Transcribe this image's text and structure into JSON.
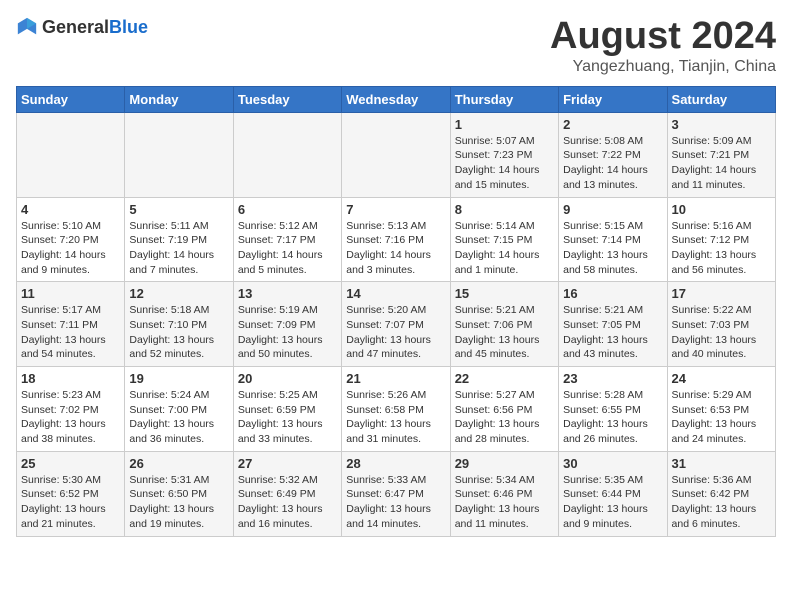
{
  "header": {
    "logo_general": "General",
    "logo_blue": "Blue",
    "title": "August 2024",
    "subtitle": "Yangezhuang, Tianjin, China"
  },
  "columns": [
    "Sunday",
    "Monday",
    "Tuesday",
    "Wednesday",
    "Thursday",
    "Friday",
    "Saturday"
  ],
  "weeks": [
    [
      {
        "day": "",
        "content": ""
      },
      {
        "day": "",
        "content": ""
      },
      {
        "day": "",
        "content": ""
      },
      {
        "day": "",
        "content": ""
      },
      {
        "day": "1",
        "content": "Sunrise: 5:07 AM\nSunset: 7:23 PM\nDaylight: 14 hours\nand 15 minutes."
      },
      {
        "day": "2",
        "content": "Sunrise: 5:08 AM\nSunset: 7:22 PM\nDaylight: 14 hours\nand 13 minutes."
      },
      {
        "day": "3",
        "content": "Sunrise: 5:09 AM\nSunset: 7:21 PM\nDaylight: 14 hours\nand 11 minutes."
      }
    ],
    [
      {
        "day": "4",
        "content": "Sunrise: 5:10 AM\nSunset: 7:20 PM\nDaylight: 14 hours\nand 9 minutes."
      },
      {
        "day": "5",
        "content": "Sunrise: 5:11 AM\nSunset: 7:19 PM\nDaylight: 14 hours\nand 7 minutes."
      },
      {
        "day": "6",
        "content": "Sunrise: 5:12 AM\nSunset: 7:17 PM\nDaylight: 14 hours\nand 5 minutes."
      },
      {
        "day": "7",
        "content": "Sunrise: 5:13 AM\nSunset: 7:16 PM\nDaylight: 14 hours\nand 3 minutes."
      },
      {
        "day": "8",
        "content": "Sunrise: 5:14 AM\nSunset: 7:15 PM\nDaylight: 14 hours\nand 1 minute."
      },
      {
        "day": "9",
        "content": "Sunrise: 5:15 AM\nSunset: 7:14 PM\nDaylight: 13 hours\nand 58 minutes."
      },
      {
        "day": "10",
        "content": "Sunrise: 5:16 AM\nSunset: 7:12 PM\nDaylight: 13 hours\nand 56 minutes."
      }
    ],
    [
      {
        "day": "11",
        "content": "Sunrise: 5:17 AM\nSunset: 7:11 PM\nDaylight: 13 hours\nand 54 minutes."
      },
      {
        "day": "12",
        "content": "Sunrise: 5:18 AM\nSunset: 7:10 PM\nDaylight: 13 hours\nand 52 minutes."
      },
      {
        "day": "13",
        "content": "Sunrise: 5:19 AM\nSunset: 7:09 PM\nDaylight: 13 hours\nand 50 minutes."
      },
      {
        "day": "14",
        "content": "Sunrise: 5:20 AM\nSunset: 7:07 PM\nDaylight: 13 hours\nand 47 minutes."
      },
      {
        "day": "15",
        "content": "Sunrise: 5:21 AM\nSunset: 7:06 PM\nDaylight: 13 hours\nand 45 minutes."
      },
      {
        "day": "16",
        "content": "Sunrise: 5:21 AM\nSunset: 7:05 PM\nDaylight: 13 hours\nand 43 minutes."
      },
      {
        "day": "17",
        "content": "Sunrise: 5:22 AM\nSunset: 7:03 PM\nDaylight: 13 hours\nand 40 minutes."
      }
    ],
    [
      {
        "day": "18",
        "content": "Sunrise: 5:23 AM\nSunset: 7:02 PM\nDaylight: 13 hours\nand 38 minutes."
      },
      {
        "day": "19",
        "content": "Sunrise: 5:24 AM\nSunset: 7:00 PM\nDaylight: 13 hours\nand 36 minutes."
      },
      {
        "day": "20",
        "content": "Sunrise: 5:25 AM\nSunset: 6:59 PM\nDaylight: 13 hours\nand 33 minutes."
      },
      {
        "day": "21",
        "content": "Sunrise: 5:26 AM\nSunset: 6:58 PM\nDaylight: 13 hours\nand 31 minutes."
      },
      {
        "day": "22",
        "content": "Sunrise: 5:27 AM\nSunset: 6:56 PM\nDaylight: 13 hours\nand 28 minutes."
      },
      {
        "day": "23",
        "content": "Sunrise: 5:28 AM\nSunset: 6:55 PM\nDaylight: 13 hours\nand 26 minutes."
      },
      {
        "day": "24",
        "content": "Sunrise: 5:29 AM\nSunset: 6:53 PM\nDaylight: 13 hours\nand 24 minutes."
      }
    ],
    [
      {
        "day": "25",
        "content": "Sunrise: 5:30 AM\nSunset: 6:52 PM\nDaylight: 13 hours\nand 21 minutes."
      },
      {
        "day": "26",
        "content": "Sunrise: 5:31 AM\nSunset: 6:50 PM\nDaylight: 13 hours\nand 19 minutes."
      },
      {
        "day": "27",
        "content": "Sunrise: 5:32 AM\nSunset: 6:49 PM\nDaylight: 13 hours\nand 16 minutes."
      },
      {
        "day": "28",
        "content": "Sunrise: 5:33 AM\nSunset: 6:47 PM\nDaylight: 13 hours\nand 14 minutes."
      },
      {
        "day": "29",
        "content": "Sunrise: 5:34 AM\nSunset: 6:46 PM\nDaylight: 13 hours\nand 11 minutes."
      },
      {
        "day": "30",
        "content": "Sunrise: 5:35 AM\nSunset: 6:44 PM\nDaylight: 13 hours\nand 9 minutes."
      },
      {
        "day": "31",
        "content": "Sunrise: 5:36 AM\nSunset: 6:42 PM\nDaylight: 13 hours\nand 6 minutes."
      }
    ]
  ]
}
